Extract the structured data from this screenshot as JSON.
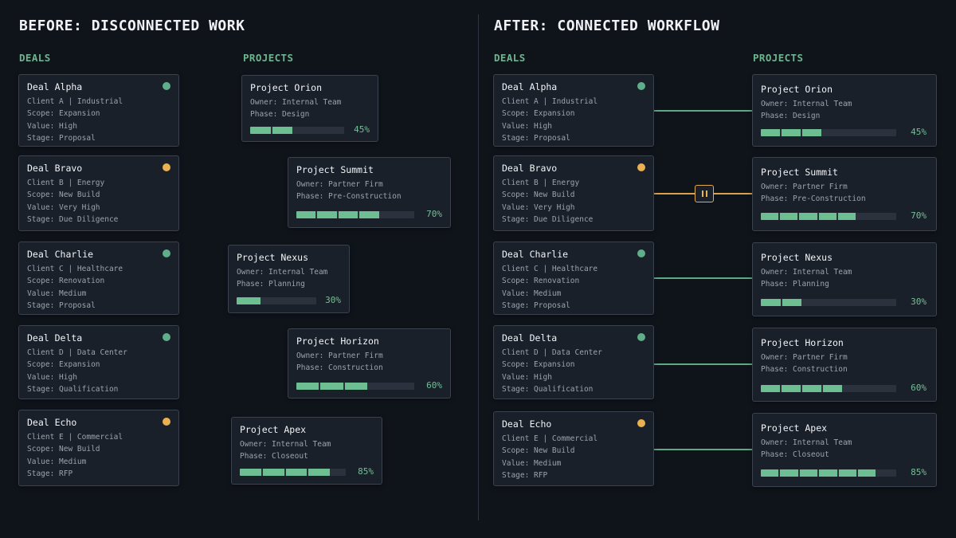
{
  "before": {
    "heading": "BEFORE: DISCONNECTED WORK",
    "deals_label": "DEALS",
    "projects_label": "PROJECTS"
  },
  "after": {
    "heading": "AFTER: CONNECTED WORKFLOW",
    "deals_label": "DEALS",
    "projects_label": "PROJECTS"
  },
  "deals": [
    {
      "name": "Deal Alpha",
      "client": "Client A |  Industrial",
      "scope": "Scope: Expansion",
      "value": "Value: High",
      "stage": "Stage: Proposal",
      "status": "green"
    },
    {
      "name": "Deal Bravo",
      "client": "Client B |  Energy",
      "scope": "Scope: New Build",
      "value": "Value: Very High",
      "stage": "Stage: Due Diligence",
      "status": "amber"
    },
    {
      "name": "Deal Charlie",
      "client": "Client C |  Healthcare",
      "scope": "Scope: Renovation",
      "value": "Value: Medium",
      "stage": "Stage: Proposal",
      "status": "green"
    },
    {
      "name": "Deal Delta",
      "client": "Client D |  Data Center",
      "scope": "Scope: Expansion",
      "value": "Value: High",
      "stage": "Stage: Qualification",
      "status": "green"
    },
    {
      "name": "Deal Echo",
      "client": "Client E |  Commercial",
      "scope": "Scope: New Build",
      "value": "Value: Medium",
      "stage": "Stage: RFP",
      "status": "amber"
    }
  ],
  "projects": [
    {
      "name": "Project Orion",
      "owner": "Owner: Internal Team",
      "phase": "Phase: Design",
      "progress": 45,
      "progress_label": "45%"
    },
    {
      "name": "Project Summit",
      "owner": "Owner: Partner Firm",
      "phase": "Phase: Pre-Construction",
      "progress": 70,
      "progress_label": "70%"
    },
    {
      "name": "Project Nexus",
      "owner": "Owner: Internal Team",
      "phase": "Phase: Planning",
      "progress": 30,
      "progress_label": "30%"
    },
    {
      "name": "Project Horizon",
      "owner": "Owner: Partner Firm",
      "phase": "Phase: Construction",
      "progress": 60,
      "progress_label": "60%"
    },
    {
      "name": "Project Apex",
      "owner": "Owner: Internal Team",
      "phase": "Phase: Closeout",
      "progress": 85,
      "progress_label": "85%"
    }
  ],
  "colors": {
    "background": "#0f141b",
    "accent_green": "#6fb48e",
    "accent_amber": "#e6a84a",
    "card": "#1a2029"
  },
  "icons": {
    "connector_blocked": "pause-icon",
    "deal_status": "status-dot"
  }
}
